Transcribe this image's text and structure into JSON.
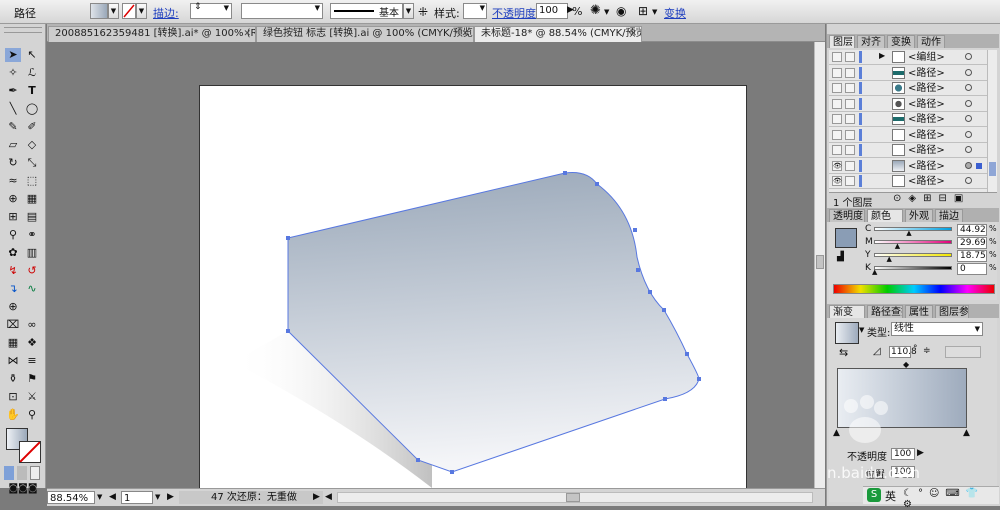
{
  "control_bar": {
    "object_type": "路径",
    "stroke_label": "描边:",
    "stroke_style": "基本",
    "style_label": "样式:",
    "opacity_label": "不透明度:",
    "opacity_value": "100",
    "opacity_unit": "%",
    "transform_label": "变换"
  },
  "tabs": [
    {
      "label": "200885162359481 [转换].ai* @ 100% (RGB/预览)",
      "active": false
    },
    {
      "label": "绿色按钮 标志 [转换].ai @ 100% (CMYK/预览)",
      "active": false
    },
    {
      "label": "未标题-18* @ 88.54% (CMYK/预览)",
      "active": true
    }
  ],
  "status": {
    "zoom": "88.54%",
    "page": "1",
    "message": "47 次还原：无重做"
  },
  "layers_panel": {
    "tabs": [
      "图层",
      "对齐",
      "变换",
      "动作"
    ],
    "rows": [
      {
        "name": "<编组>",
        "thumb": "blank"
      },
      {
        "name": "<路径>",
        "thumb": "teal-bar"
      },
      {
        "name": "<路径>",
        "thumb": "teal-shape"
      },
      {
        "name": "<路径>",
        "thumb": "dark-shape"
      },
      {
        "name": "<路径>",
        "thumb": "teal-bar"
      },
      {
        "name": "<路径>",
        "thumb": "blank"
      },
      {
        "name": "<路径>",
        "thumb": "blank"
      },
      {
        "name": "<路径>",
        "thumb": "gradient-shape"
      },
      {
        "name": "<路径>",
        "thumb": "blank"
      }
    ],
    "footer_count": "1 个图层"
  },
  "color_panel": {
    "tabs": [
      "透明度",
      "颜色",
      "外观",
      "描边"
    ],
    "channels": [
      {
        "label": "C",
        "value": "44.92",
        "grad_from": "#ffffff",
        "grad_to": "#00a0e0",
        "pos": 0.45
      },
      {
        "label": "M",
        "value": "29.69",
        "grad_from": "#ffffff",
        "grad_to": "#e0007a",
        "pos": 0.3
      },
      {
        "label": "Y",
        "value": "18.75",
        "grad_from": "#ffffff",
        "grad_to": "#f2e600",
        "pos": 0.19
      },
      {
        "label": "K",
        "value": "0",
        "grad_from": "#ffffff",
        "grad_to": "#000000",
        "pos": 0.0
      }
    ],
    "fill_color": "#8a9db5"
  },
  "gradient_panel": {
    "tabs": [
      "渐变",
      "路径查找",
      "属性",
      "图层参考"
    ],
    "type_label": "类型:",
    "type_value": "线性",
    "angle": "110.8",
    "angle_unit": "°",
    "opacity_label": "不透明度",
    "opacity_value": "100",
    "location_label": "位置",
    "location_value": "100",
    "stop_start_color": "#e9edf2",
    "stop_end_color": "#9eabbd"
  },
  "artwork": {
    "fill_top": "#9aa8b9",
    "fill_bottom": "#f4f5f8",
    "path_color": "#5878e0",
    "shadow_color": "#b9b9b9"
  },
  "taskbar": {
    "ime": "英"
  },
  "watermark": {
    "text": "n.baidu.com"
  }
}
